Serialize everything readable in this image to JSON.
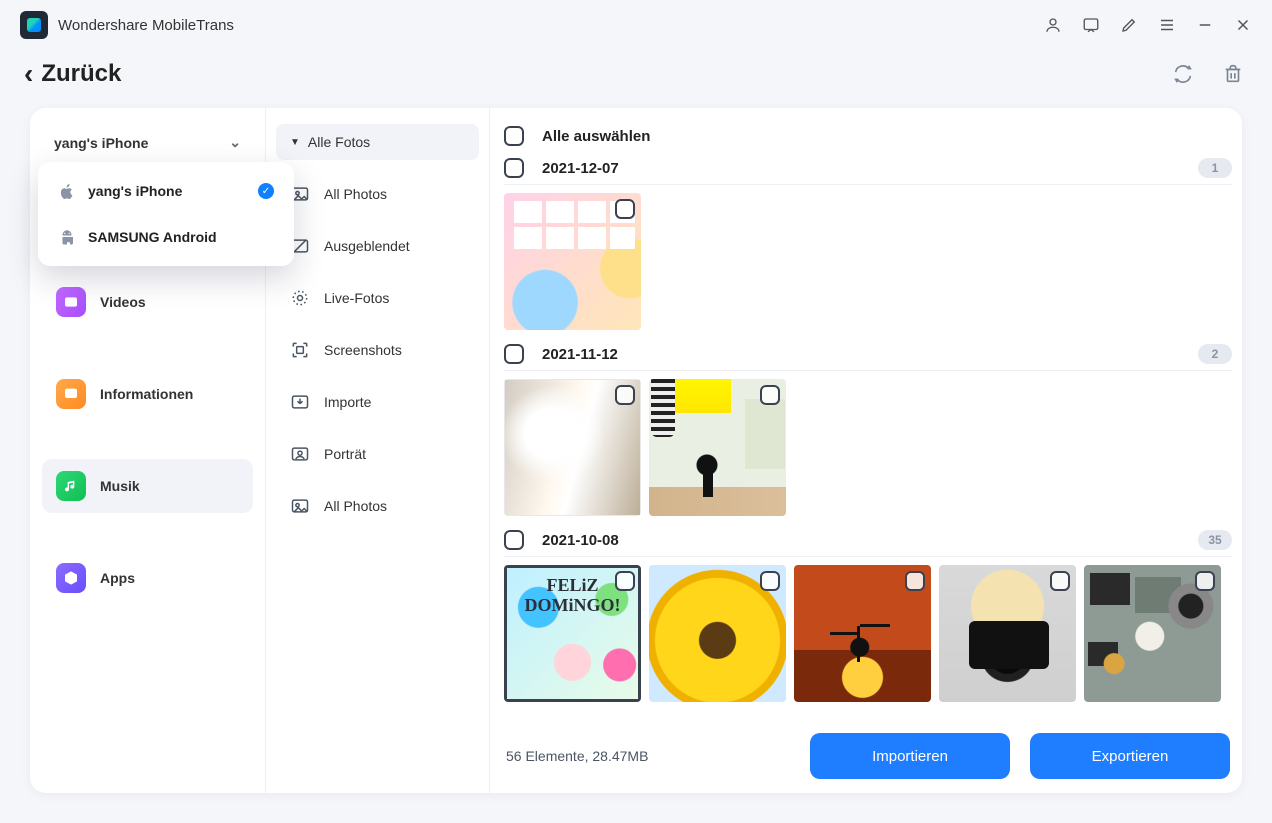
{
  "app": {
    "title": "Wondershare MobileTrans"
  },
  "back": {
    "label": "Zurück"
  },
  "device_selector": {
    "current": "yang's iPhone",
    "options": [
      {
        "label": "yang's iPhone",
        "selected": true,
        "platform": "apple"
      },
      {
        "label": "SAMSUNG Android",
        "selected": false,
        "platform": "android"
      }
    ]
  },
  "sidebar": {
    "items": [
      {
        "key": "videos",
        "label": "Videos",
        "active": false
      },
      {
        "key": "info",
        "label": "Informationen",
        "active": false
      },
      {
        "key": "music",
        "label": "Musik",
        "active": true
      },
      {
        "key": "apps",
        "label": "Apps",
        "active": false
      }
    ]
  },
  "categories": {
    "header": "Alle Fotos",
    "items": [
      {
        "label": "All Photos"
      },
      {
        "label": "Ausgeblendet"
      },
      {
        "label": "Live-Fotos"
      },
      {
        "label": "Screenshots"
      },
      {
        "label": "Importe"
      },
      {
        "label": "Porträt"
      },
      {
        "label": "All Photos"
      }
    ]
  },
  "content": {
    "select_all_label": "Alle auswählen",
    "groups": [
      {
        "date": "2021-12-07",
        "count": "1"
      },
      {
        "date": "2021-11-12",
        "count": "2"
      },
      {
        "date": "2021-10-08",
        "count": "35"
      }
    ]
  },
  "footer": {
    "status": "56 Elemente, 28.47MB",
    "import_label": "Importieren",
    "export_label": "Exportieren"
  }
}
